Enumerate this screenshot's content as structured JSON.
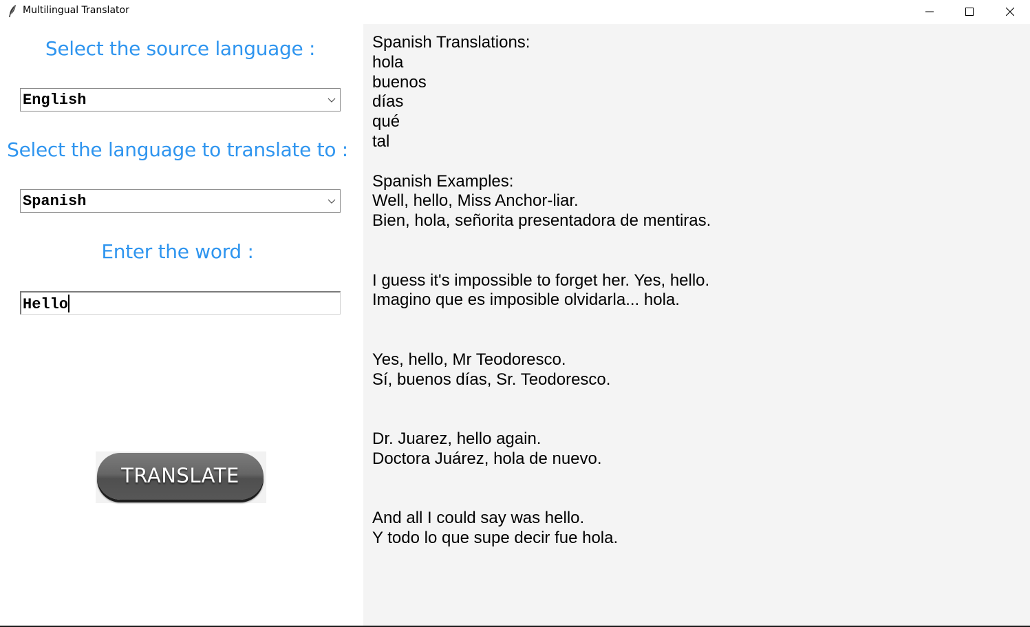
{
  "window": {
    "title": "Multilingual Translator",
    "icon": "feather-icon"
  },
  "form": {
    "source_label": "Select the source language :",
    "source_language": "English",
    "target_label": "Select the language to translate to :",
    "target_language": "Spanish",
    "word_label": "Enter the word :",
    "word_value": "Hello",
    "translate_button": "TRANSLATE"
  },
  "output": {
    "text": "Spanish Translations:\nhola\nbuenos\ndías\nqué\ntal\n\nSpanish Examples:\nWell, hello, Miss Anchor-liar.\nBien, hola, señorita presentadora de mentiras.\n\n\nI guess it's impossible to forget her. Yes, hello.\nImagino que es imposible olvidarla... hola.\n\n\nYes, hello, Mr Teodoresco.\nSí, buenos días, Sr. Teodoresco.\n\n\nDr. Juarez, hello again.\nDoctora Juárez, hola de nuevo.\n\n\nAnd all I could say was hello.\nY todo lo que supe decir fue hola."
  },
  "colors": {
    "label_blue": "#2f95ef",
    "output_background": "#f4f4f4",
    "button_gray": "#666666"
  }
}
